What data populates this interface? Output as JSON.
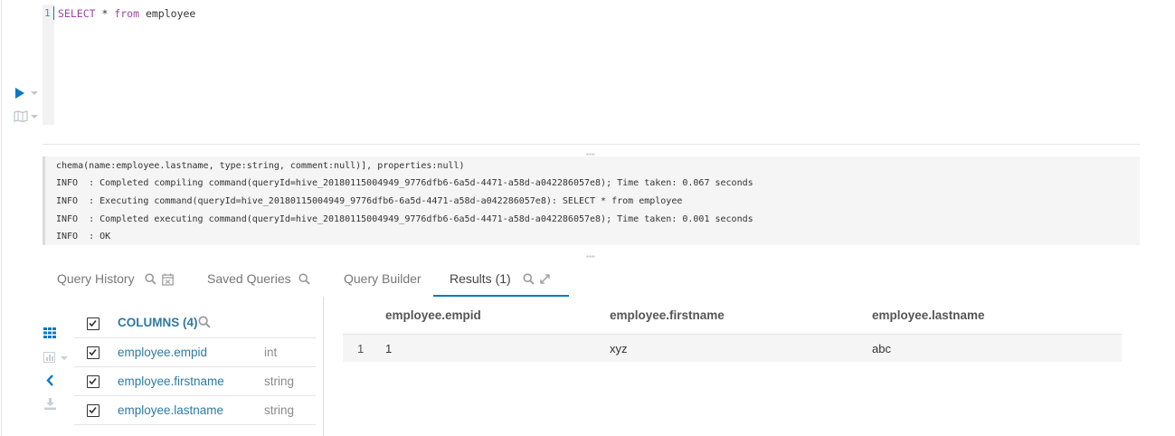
{
  "editor": {
    "line_number": "1",
    "sql_keyword_1": "SELECT",
    "sql_rest_1": " * ",
    "sql_keyword_2": "from",
    "sql_rest_2": " employee",
    "run_icon": "play-icon",
    "map_icon": "map-icon"
  },
  "log": {
    "lines": [
      "chema(name:employee.lastname, type:string, comment:null)], properties:null)",
      "INFO  : Completed compiling command(queryId=hive_20180115004949_9776dfb6-6a5d-4471-a58d-a042286057e8); Time taken: 0.067 seconds",
      "INFO  : Executing command(queryId=hive_20180115004949_9776dfb6-6a5d-4471-a58d-a042286057e8): SELECT * from employee",
      "INFO  : Completed executing command(queryId=hive_20180115004949_9776dfb6-6a5d-4471-a58d-a042286057e8); Time taken: 0.001 seconds",
      "INFO  : OK"
    ]
  },
  "tabs": {
    "query_history": "Query History",
    "saved_queries": "Saved Queries",
    "query_builder": "Query Builder",
    "results": "Results (1)",
    "active": "results"
  },
  "columns_panel": {
    "header": "COLUMNS (4)",
    "columns": [
      {
        "name": "employee.empid",
        "type": "int",
        "checked": true
      },
      {
        "name": "employee.firstname",
        "type": "string",
        "checked": true
      },
      {
        "name": "employee.lastname",
        "type": "string",
        "checked": true
      }
    ]
  },
  "results_grid": {
    "headers": [
      "employee.empid",
      "employee.firstname",
      "employee.lastname"
    ],
    "rows": [
      {
        "index": "1",
        "cells": [
          "1",
          "xyz",
          "abc"
        ]
      }
    ]
  },
  "colors": {
    "accent": "#0b78c6",
    "link": "#2e7aa3",
    "sql_keyword": "#9b44a2"
  }
}
